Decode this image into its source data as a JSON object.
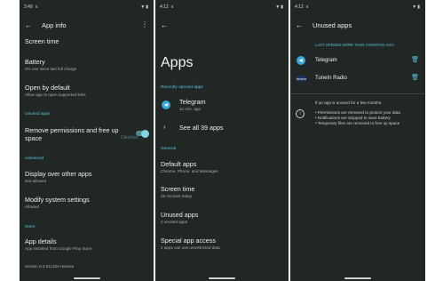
{
  "panel1": {
    "status": {
      "time": "3:49",
      "indicator": "5"
    },
    "title": "App info",
    "items": [
      {
        "title": "Screen time",
        "sub": ""
      },
      {
        "title": "Battery",
        "sub": "0% use since last full charge"
      },
      {
        "title": "Open by default",
        "sub": "Allow app to open supported links"
      }
    ],
    "unused_section": "Unused apps",
    "remove_perm": "Remove permissions and free up space",
    "watermark": "Ctechies",
    "advanced_section": "Advanced",
    "display_over": {
      "title": "Display over other apps",
      "sub": "Not allowed"
    },
    "modify_settings": {
      "title": "Modify system settings",
      "sub": "Allowed"
    },
    "store_section": "Store",
    "app_details": {
      "title": "App details",
      "sub": "App installed from Google Play Store"
    },
    "version": "version 6.3.611324-release"
  },
  "panel2": {
    "status": {
      "time": "4:12",
      "indicator": "5"
    },
    "heading": "Apps",
    "recent_section": "Recently opened apps",
    "recent_app": {
      "name": "Telegram",
      "time": "12 min. ago"
    },
    "see_all": "See all 39 apps",
    "general_section": "General",
    "items": [
      {
        "title": "Default apps",
        "sub": "Chrome, Phone, and Messages"
      },
      {
        "title": "Screen time",
        "sub": "26 minutes today"
      },
      {
        "title": "Unused apps",
        "sub": "2 unused apps"
      },
      {
        "title": "Special app access",
        "sub": "2 apps can use unrestricted data"
      }
    ]
  },
  "panel3": {
    "status": {
      "time": "4:12",
      "indicator": "5"
    },
    "title": "Unused apps",
    "last_opened": "LAST OPENED MORE THAN 3 MONTHS AGO",
    "apps": [
      {
        "name": "Telegram",
        "icon": "telegram-icon"
      },
      {
        "name": "TuneIn Radio",
        "icon": "tunein-icon",
        "icon_label": "tunein"
      }
    ],
    "info_lines": [
      "If an app is unused for a few months:",
      "",
      "• Permissions are removed to protect your data",
      "• Notifications are stopped to save battery",
      "• Temporary files are removed to free up space"
    ]
  },
  "colors": {
    "background": "#202725",
    "accent": "#5cc6dc",
    "telegram": "#3ba7d8"
  }
}
